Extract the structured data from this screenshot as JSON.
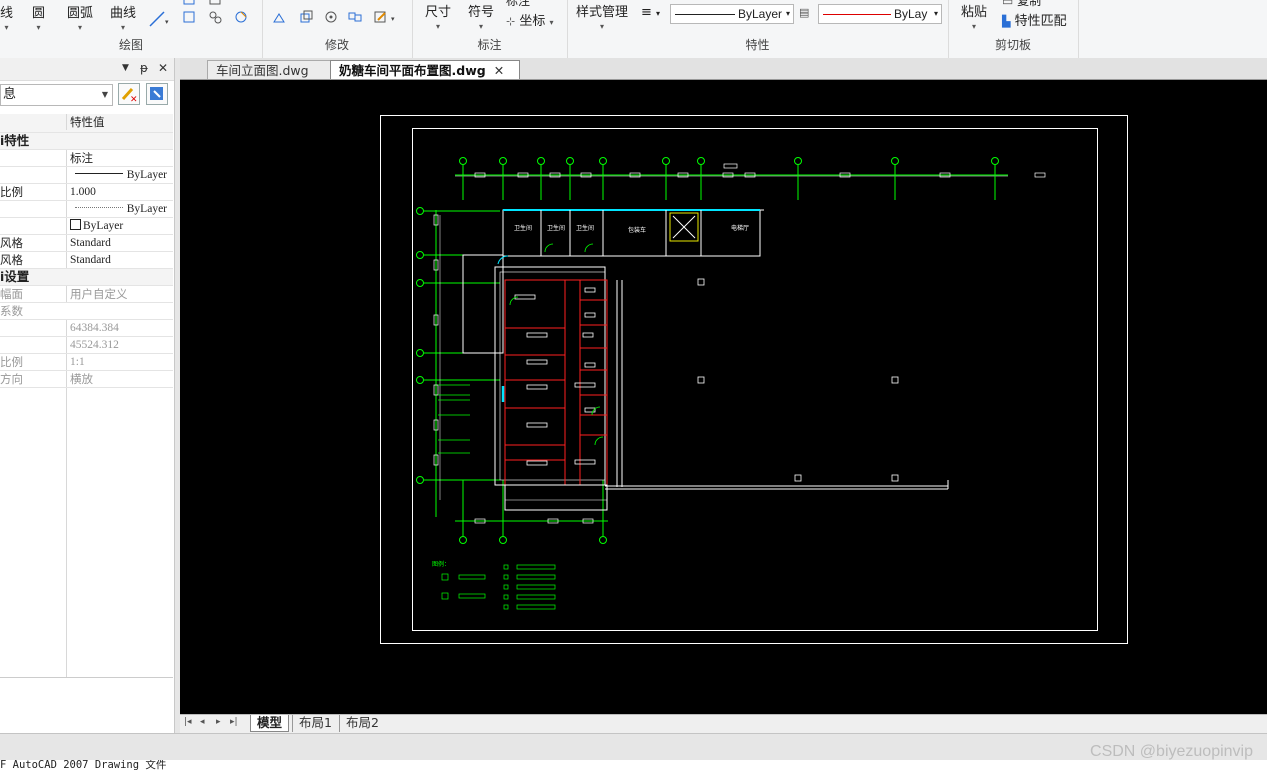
{
  "ribbon": {
    "draw_group": {
      "title": "绘图",
      "line": "线",
      "circle": "圆",
      "arc": "圆弧",
      "curve": "曲线"
    },
    "modify_group": {
      "title": "修改"
    },
    "annotate_group": {
      "title": "标注",
      "dimension": "尺寸",
      "symbol": "符号",
      "coordinate": "坐标",
      "top_cut": "标注"
    },
    "property_group": {
      "title": "特性",
      "style_manager": "样式管理",
      "linetype_value": "ByLayer",
      "color_value": "ByLay"
    },
    "clipboard_group": {
      "title": "剪切板",
      "paste": "粘贴",
      "match_properties": "特性匹配",
      "top_cut": "复制"
    }
  },
  "palette": {
    "selector_value": "息",
    "header_col2": "特性值",
    "rows": [
      {
        "type": "section",
        "c1": "i特性",
        "c2": ""
      },
      {
        "type": "row",
        "c1": "",
        "c2": "标注"
      },
      {
        "type": "row",
        "c1": "",
        "c2": "ByLayer"
      },
      {
        "type": "row",
        "c1": "比例",
        "c2": "1.000"
      },
      {
        "type": "row",
        "c1": "",
        "c2": "ByLayer"
      },
      {
        "type": "row",
        "c1": "",
        "c2": "ByLayer"
      },
      {
        "type": "row",
        "c1": "风格",
        "c2": "Standard"
      },
      {
        "type": "row",
        "c1": "风格",
        "c2": "Standard"
      },
      {
        "type": "section",
        "c1": "i设置",
        "c2": ""
      },
      {
        "type": "gray",
        "c1": "幅面",
        "c2": "用户自定义"
      },
      {
        "type": "gray",
        "c1": "系数",
        "c2": ""
      },
      {
        "type": "gray",
        "c1": "",
        "c2": "64384.384"
      },
      {
        "type": "gray",
        "c1": "",
        "c2": "45524.312"
      },
      {
        "type": "gray",
        "c1": "比例",
        "c2": "1:1"
      },
      {
        "type": "gray",
        "c1": "方向",
        "c2": "横放"
      }
    ]
  },
  "doc_tabs": [
    {
      "label": "车间立面图.dwg",
      "active": false
    },
    {
      "label": "奶糖车间平面布置图.dwg",
      "active": true
    }
  ],
  "drawing": {
    "room_labels": [
      "卫生间",
      "卫生间",
      "卫生间",
      "包装车",
      "电梯厅"
    ],
    "legend_title": "图例："
  },
  "layout_tabs": [
    {
      "label": "模型",
      "active": true
    },
    {
      "label": "布局1",
      "active": false
    },
    {
      "label": "布局2",
      "active": false
    }
  ],
  "status_text": "F AutoCAD 2007 Drawing 文件",
  "watermark": "CSDN @biyezuopinvip",
  "colors": {
    "canvas": "#000000",
    "green": "#00ff00",
    "red": "#ff0000",
    "cyan": "#00ffff",
    "white": "#ffffff",
    "yellow": "#ffff00"
  }
}
